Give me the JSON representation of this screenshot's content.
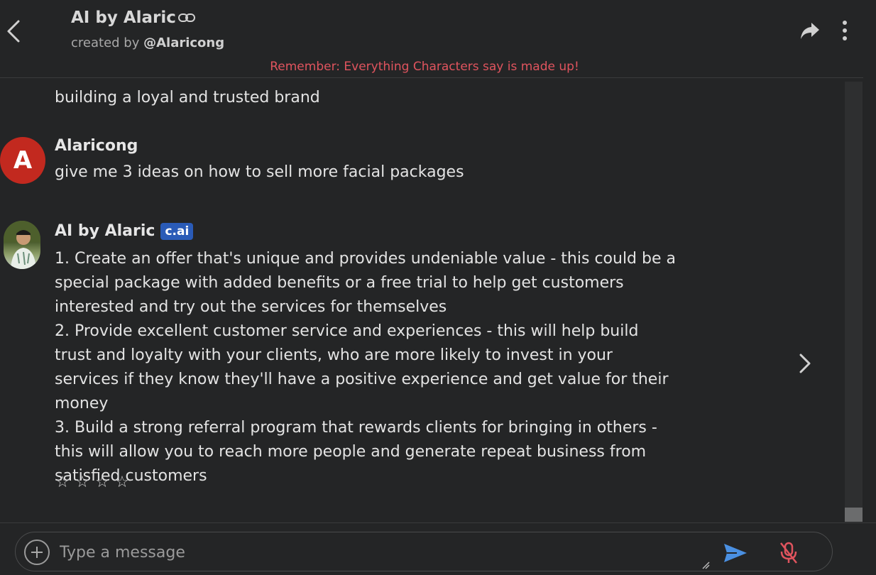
{
  "header": {
    "title": "AI by Alaric",
    "created_by_prefix": "created by ",
    "creator_handle": "@Alaricong",
    "disclaimer": "Remember: Everything Characters say is made up!"
  },
  "chat": {
    "partial_previous_message": "building a loyal and trusted brand",
    "user_message": {
      "avatar_letter": "A",
      "name": "Alaricong",
      "text": "give me 3 ideas on how to sell more facial packages"
    },
    "bot_message": {
      "name": "AI by Alaric",
      "badge": "c.ai",
      "lines": [
        "1. Create an offer that's unique and provides undeniable value - this could be a special package with added benefits or a free trial to help get customers interested and try out the services for themselves",
        "2. Provide excellent customer service and experiences - this will help build trust and loyalty with your clients, who are more likely to invest in your services if they know they'll have a positive experience and get value for their money",
        "3. Build a strong referral program that rewards clients for bringing in others - this will allow you to reach more people and generate repeat business from satisfied customers"
      ],
      "rating_stars": [
        "☆",
        "☆",
        "☆",
        "☆"
      ]
    }
  },
  "input": {
    "placeholder": "Type a message",
    "value": ""
  },
  "colors": {
    "background": "#242526",
    "disclaimer": "#e0545e",
    "user_avatar": "#c2291f",
    "badge": "#2a5bb7",
    "send_icon": "#4a90e2",
    "mic_muted_icon": "#e0545e"
  }
}
